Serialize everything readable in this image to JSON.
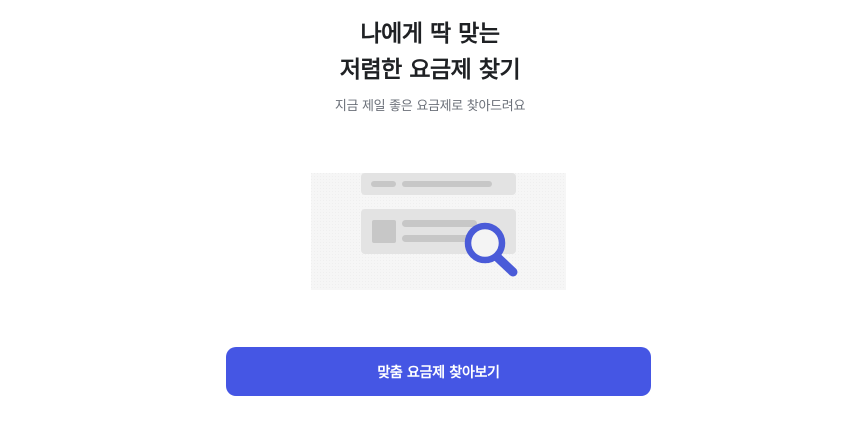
{
  "hero": {
    "title_line1": "나에게 딱 맞는",
    "title_line2": "저렴한 요금제 찾기",
    "subtitle": "지금 제일 좋은 요금제로 찾아드려요"
  },
  "illustration": {
    "icon": "magnifier-icon",
    "accent_color": "#4a5bd8"
  },
  "cta": {
    "label": "맞춤 요금제 찾아보기",
    "color": "#4556e4"
  }
}
